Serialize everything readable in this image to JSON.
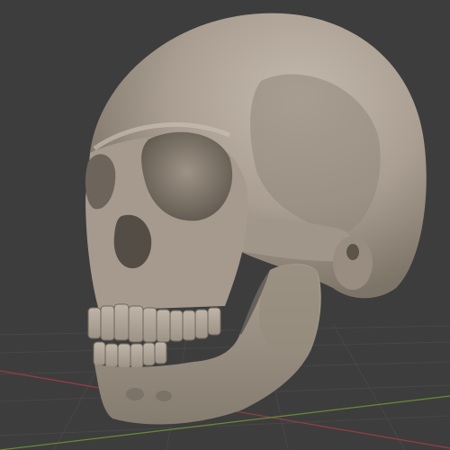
{
  "viewport": {
    "background_color": "#3d3d3d",
    "grid_line_color": "#474747",
    "x_axis_color": "#9a3c48",
    "y_axis_color": "#6b8a35"
  },
  "model": {
    "subject": "skull-sculpt",
    "material_color": "#a99e91",
    "shadow_color": "#6c645a",
    "highlight_color": "#c3b9ac"
  }
}
